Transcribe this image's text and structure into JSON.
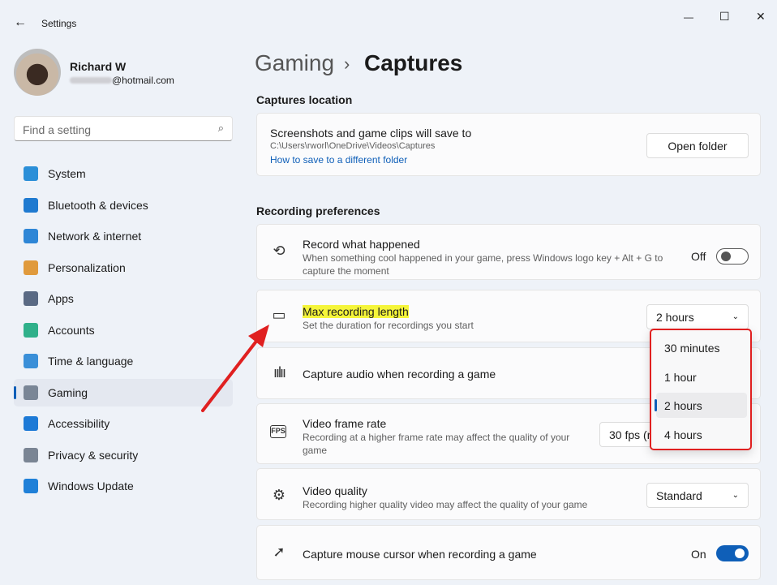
{
  "window": {
    "title": "Settings",
    "back": "←",
    "minimize": "—",
    "maximize": "☐",
    "close": "✕"
  },
  "user": {
    "name": "Richard W",
    "email": "@hotmail.com"
  },
  "search": {
    "placeholder": "Find a setting"
  },
  "sidebar": {
    "items": [
      {
        "label": "System",
        "color": "#2b8fd8"
      },
      {
        "label": "Bluetooth & devices",
        "color": "#1f7ad0"
      },
      {
        "label": "Network & internet",
        "color": "#2e86d6"
      },
      {
        "label": "Personalization",
        "color": "#e09a3c"
      },
      {
        "label": "Apps",
        "color": "#5a6a84"
      },
      {
        "label": "Accounts",
        "color": "#2fb08a"
      },
      {
        "label": "Time & language",
        "color": "#3a8fd8"
      },
      {
        "label": "Gaming",
        "color": "#7a8696"
      },
      {
        "label": "Accessibility",
        "color": "#1d7ad6"
      },
      {
        "label": "Privacy & security",
        "color": "#7a8594"
      },
      {
        "label": "Windows Update",
        "color": "#1f80d8"
      }
    ],
    "selected": "Gaming"
  },
  "breadcrumb": {
    "parent": "Gaming",
    "sep": "›",
    "current": "Captures"
  },
  "captures_location": {
    "heading": "Captures location",
    "title": "Screenshots and game clips will save to",
    "path": "C:\\Users\\rworl\\OneDrive\\Videos\\Captures",
    "link": "How to save to a different folder",
    "button": "Open folder"
  },
  "recording": {
    "heading": "Recording preferences",
    "record_what_happened": {
      "title": "Record what happened",
      "desc": "When something cool happened in your game, press Windows logo key + Alt + G to capture the moment",
      "state": "Off"
    },
    "max_length": {
      "title": "Max recording length",
      "desc": "Set the duration for recordings you start",
      "value": "2 hours",
      "options": [
        "30 minutes",
        "1 hour",
        "2 hours",
        "4 hours"
      ]
    },
    "capture_audio": {
      "title": "Capture audio when recording a game"
    },
    "frame_rate": {
      "title": "Video frame rate",
      "desc": "Recording at a higher frame rate may affect the quality of your game",
      "value": "30 fps (r"
    },
    "quality": {
      "title": "Video quality",
      "desc": "Recording higher quality video may affect the quality of your game",
      "value": "Standard"
    },
    "mouse_cursor": {
      "title": "Capture mouse cursor when recording a game",
      "state": "On"
    }
  },
  "colors": {
    "accent": "#0f5fb8",
    "highlight": "#f5f53a",
    "annotation": "#e02020"
  }
}
